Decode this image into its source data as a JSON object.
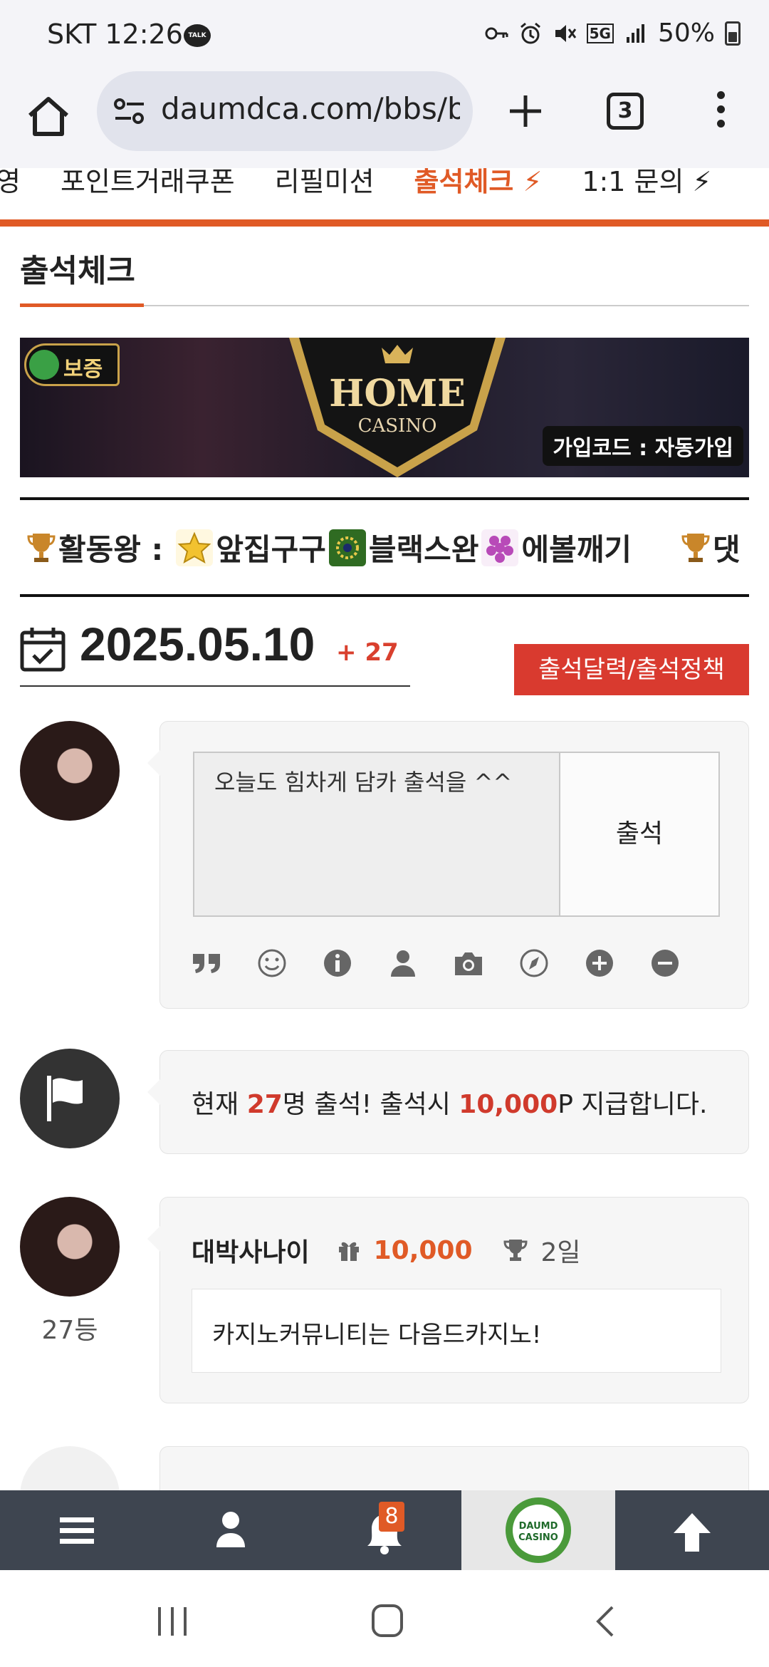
{
  "status_bar": {
    "carrier_time": "SKT 12:26",
    "battery": "50%",
    "network": "5G"
  },
  "browser": {
    "url": "daumdca.com/bbs/b",
    "tab_count": "3"
  },
  "site_nav": {
    "items": [
      {
        "label": "영",
        "active": false
      },
      {
        "label": "포인트거래쿠폰",
        "active": false
      },
      {
        "label": "리필미션",
        "active": false
      },
      {
        "label": "출석체크",
        "active": true
      },
      {
        "label": "1:1 문의",
        "active": false
      }
    ],
    "accent_color": "#e05a26"
  },
  "page": {
    "title": "출석체크"
  },
  "banner": {
    "badge_label": "보증",
    "brand_top": "HOME",
    "brand_bottom": "CASINO",
    "signup_code": "가입코드 : 자동가입"
  },
  "ticker": {
    "title": "활동왕 :",
    "members": [
      "앞집구구",
      "블랙스완",
      "에볼깨기"
    ],
    "next_title": "댓"
  },
  "attendance": {
    "date": "2025.05.10",
    "plus_count": "+ 27",
    "policy_button": "출석달력/출석정책"
  },
  "compose": {
    "placeholder": "오늘도 힘차게 담카 출석을 ^^",
    "submit_label": "출석",
    "tools": [
      "quote-icon",
      "smile-icon",
      "info-icon",
      "user-icon",
      "camera-icon",
      "compass-icon",
      "plus-circle-icon",
      "minus-circle-icon"
    ]
  },
  "notice": {
    "prefix": "현재 ",
    "count": "27",
    "middle": "명 출석! 출석시 ",
    "points": "10,000",
    "suffix": "P 지급합니다."
  },
  "entries": [
    {
      "nickname": "대박사나이",
      "points": "10,000",
      "days": "2일",
      "message": "카지노커뮤니티는 다음드카지노!",
      "rank": "27등"
    }
  ],
  "bottom_bar": {
    "notification_count": "8",
    "logo_top": "DAUMD",
    "logo_bottom": "CASINO"
  }
}
